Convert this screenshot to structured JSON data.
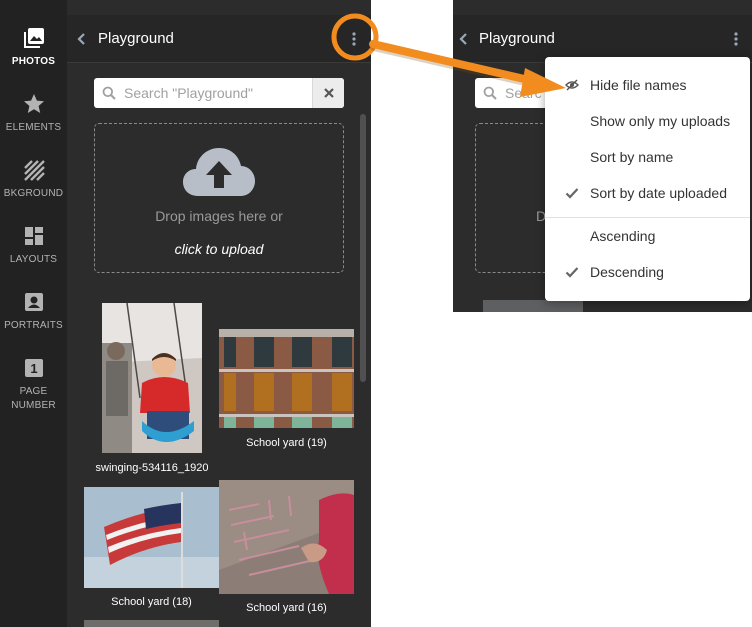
{
  "sidebar": {
    "items": [
      {
        "label": "PHOTOS",
        "icon": "photos-icon",
        "active": true
      },
      {
        "label": "ELEMENTS",
        "icon": "star-icon",
        "active": false
      },
      {
        "label": "BKGROUND",
        "icon": "background-hatch-icon",
        "active": false
      },
      {
        "label": "LAYOUTS",
        "icon": "layout-grid-icon",
        "active": false
      },
      {
        "label": "PORTRAITS",
        "icon": "portrait-icon",
        "active": false
      },
      {
        "label": "PAGE",
        "label2": "NUMBER",
        "icon": "page-number-icon",
        "active": false
      }
    ],
    "page_number_glyph": "1"
  },
  "panel": {
    "title": "Playground",
    "search_placeholder": "Search \"Playground\"",
    "drop_text": "Drop images here or",
    "upload_text": "click to upload",
    "photos": [
      {
        "caption": "swinging-534116_1920",
        "subject": "child on swing"
      },
      {
        "caption": "School yard (19)",
        "subject": "brick school building"
      },
      {
        "caption": "School yard (18)",
        "subject": "american flag"
      },
      {
        "caption": "School yard (16)",
        "subject": "chalk on sidewalk"
      }
    ]
  },
  "secondary": {
    "title": "Playground",
    "search_fragment": "Searc",
    "drop_fragment": "D"
  },
  "menu": {
    "items": [
      {
        "label": "Hide file names",
        "icon": "eye-slash-icon"
      },
      {
        "label": "Show only my uploads",
        "icon": ""
      },
      {
        "label": "Sort by name",
        "icon": ""
      },
      {
        "label": "Sort by date uploaded",
        "icon": "check-icon",
        "checked": true
      },
      {
        "label": "Ascending",
        "icon": ""
      },
      {
        "label": "Descending",
        "icon": "check-icon",
        "checked": true
      }
    ]
  },
  "colors": {
    "rail_bg": "#222222",
    "panel_bg": "#2c2c2c",
    "annotation_orange": "#f28c1e",
    "icon_slate": "#9aa7b8"
  }
}
